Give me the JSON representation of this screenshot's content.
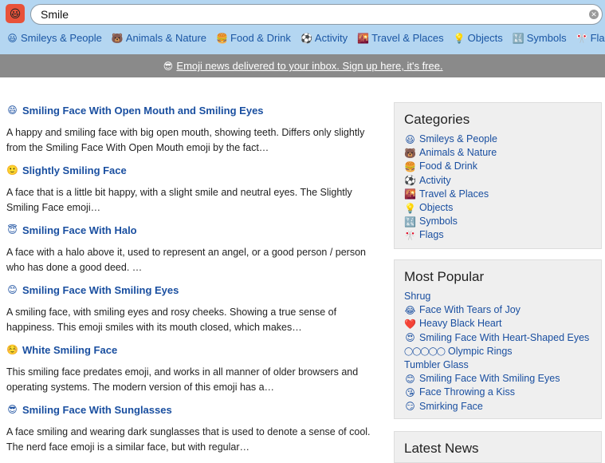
{
  "search": {
    "value": "Smile"
  },
  "nav": [
    {
      "icon": "😃",
      "label": "Smileys & People"
    },
    {
      "icon": "🐻",
      "label": "Animals & Nature"
    },
    {
      "icon": "🍔",
      "label": "Food & Drink"
    },
    {
      "icon": "⚽",
      "label": "Activity"
    },
    {
      "icon": "🌇",
      "label": "Travel & Places"
    },
    {
      "icon": "💡",
      "label": "Objects"
    },
    {
      "icon": "🔣",
      "label": "Symbols"
    },
    {
      "icon": "🎌",
      "label": "Flags"
    }
  ],
  "banner": {
    "icon": "😎",
    "text": "Emoji news delivered to your inbox. Sign up here, it's free."
  },
  "results": [
    {
      "icon": "😄",
      "title": "Smiling Face With Open Mouth and Smiling Eyes",
      "desc": "A happy and smiling face with big open mouth, showing teeth. Differs only slightly from the Smiling Face With Open Mouth emoji by the fact…"
    },
    {
      "icon": "🙂",
      "title": "Slightly Smiling Face",
      "desc": "A face that is a little bit happy, with a slight smile and neutral eyes. The Slightly Smiling Face emoji…"
    },
    {
      "icon": "😇",
      "title": "Smiling Face With Halo",
      "desc": "A face with a halo above it, used to represent an angel, or a good person / person who has done a good deed. …"
    },
    {
      "icon": "😊",
      "title": "Smiling Face With Smiling Eyes",
      "desc": "A smiling face, with smiling eyes and rosy cheeks. Showing a true sense of happiness. This emoji smiles with its mouth closed, which makes…"
    },
    {
      "icon": "☺️",
      "title": "White Smiling Face",
      "desc": "This smiling face predates emoji, and works in all manner of older browsers and operating systems. The modern version of this emoji has a…"
    },
    {
      "icon": "😎",
      "title": "Smiling Face With Sunglasses",
      "desc": "A face smiling and wearing dark sunglasses that is used to denote a sense of cool. The nerd face emoji is a similar face, but with regular…"
    }
  ],
  "categories": {
    "title": "Categories",
    "items": [
      {
        "icon": "😃",
        "label": "Smileys & People"
      },
      {
        "icon": "🐻",
        "label": "Animals & Nature"
      },
      {
        "icon": "🍔",
        "label": "Food & Drink"
      },
      {
        "icon": "⚽",
        "label": "Activity"
      },
      {
        "icon": "🌇",
        "label": "Travel & Places"
      },
      {
        "icon": "💡",
        "label": "Objects"
      },
      {
        "icon": "🔣",
        "label": "Symbols"
      },
      {
        "icon": "🎌",
        "label": "Flags"
      }
    ]
  },
  "popular": {
    "title": "Most Popular",
    "items": [
      {
        "icon": "",
        "label": "Shrug"
      },
      {
        "icon": "😂",
        "label": "Face With Tears of Joy"
      },
      {
        "icon": "❤️",
        "label": "Heavy Black Heart"
      },
      {
        "icon": "😍",
        "label": "Smiling Face With Heart-Shaped Eyes"
      },
      {
        "icon": "◯◯◯◯◯",
        "label": "Olympic Rings"
      },
      {
        "icon": "",
        "label": "Tumbler Glass"
      },
      {
        "icon": "😊",
        "label": "Smiling Face With Smiling Eyes"
      },
      {
        "icon": "😘",
        "label": "Face Throwing a Kiss"
      },
      {
        "icon": "😏",
        "label": "Smirking Face"
      }
    ]
  },
  "latest": {
    "title": "Latest News"
  }
}
